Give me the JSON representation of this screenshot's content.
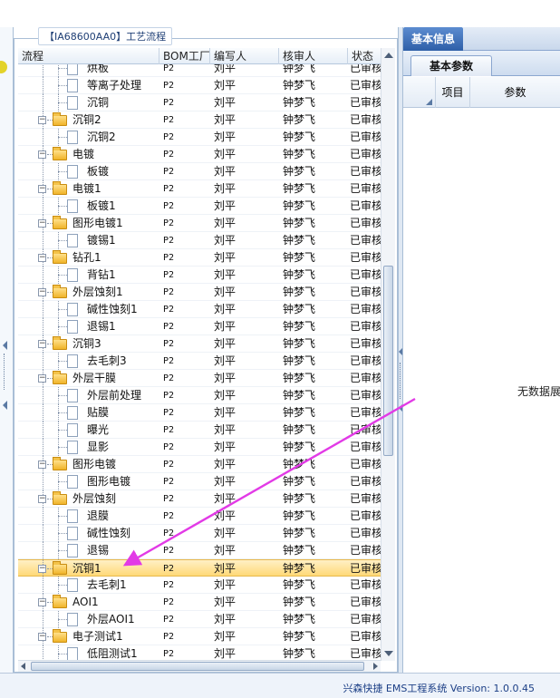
{
  "group_title": "【IA68600AA0】工艺流程",
  "columns": [
    "流程",
    "BOM工厂",
    "编写人",
    "核审人",
    "状态"
  ],
  "rows": [
    {
      "level": 1,
      "label": "烘板",
      "bom": "P2",
      "writer": "刘平",
      "reviewer": "钟梦飞",
      "status": "已审核",
      "selected": false
    },
    {
      "level": 1,
      "label": "等离子处理",
      "bom": "P2",
      "writer": "刘平",
      "reviewer": "钟梦飞",
      "status": "已审核",
      "selected": false
    },
    {
      "level": 1,
      "label": "沉铜",
      "bom": "P2",
      "writer": "刘平",
      "reviewer": "钟梦飞",
      "status": "已审核",
      "selected": false
    },
    {
      "level": 0,
      "label": "沉铜2",
      "bom": "P2",
      "writer": "刘平",
      "reviewer": "钟梦飞",
      "status": "已审核",
      "selected": false
    },
    {
      "level": 1,
      "label": "沉铜2",
      "bom": "P2",
      "writer": "刘平",
      "reviewer": "钟梦飞",
      "status": "已审核",
      "selected": false
    },
    {
      "level": 0,
      "label": "电镀",
      "bom": "P2",
      "writer": "刘平",
      "reviewer": "钟梦飞",
      "status": "已审核",
      "selected": false
    },
    {
      "level": 1,
      "label": "板镀",
      "bom": "P2",
      "writer": "刘平",
      "reviewer": "钟梦飞",
      "status": "已审核",
      "selected": false
    },
    {
      "level": 0,
      "label": "电镀1",
      "bom": "P2",
      "writer": "刘平",
      "reviewer": "钟梦飞",
      "status": "已审核",
      "selected": false
    },
    {
      "level": 1,
      "label": "板镀1",
      "bom": "P2",
      "writer": "刘平",
      "reviewer": "钟梦飞",
      "status": "已审核",
      "selected": false
    },
    {
      "level": 0,
      "label": "图形电镀1",
      "bom": "P2",
      "writer": "刘平",
      "reviewer": "钟梦飞",
      "status": "已审核",
      "selected": false
    },
    {
      "level": 1,
      "label": "镀锡1",
      "bom": "P2",
      "writer": "刘平",
      "reviewer": "钟梦飞",
      "status": "已审核",
      "selected": false
    },
    {
      "level": 0,
      "label": "钻孔1",
      "bom": "P2",
      "writer": "刘平",
      "reviewer": "钟梦飞",
      "status": "已审核",
      "selected": false
    },
    {
      "level": 1,
      "label": "背钻1",
      "bom": "P2",
      "writer": "刘平",
      "reviewer": "钟梦飞",
      "status": "已审核",
      "selected": false
    },
    {
      "level": 0,
      "label": "外层蚀刻1",
      "bom": "P2",
      "writer": "刘平",
      "reviewer": "钟梦飞",
      "status": "已审核",
      "selected": false
    },
    {
      "level": 1,
      "label": "碱性蚀刻1",
      "bom": "P2",
      "writer": "刘平",
      "reviewer": "钟梦飞",
      "status": "已审核",
      "selected": false
    },
    {
      "level": 1,
      "label": "退锡1",
      "bom": "P2",
      "writer": "刘平",
      "reviewer": "钟梦飞",
      "status": "已审核",
      "selected": false
    },
    {
      "level": 0,
      "label": "沉铜3",
      "bom": "P2",
      "writer": "刘平",
      "reviewer": "钟梦飞",
      "status": "已审核",
      "selected": false
    },
    {
      "level": 1,
      "label": "去毛刺3",
      "bom": "P2",
      "writer": "刘平",
      "reviewer": "钟梦飞",
      "status": "已审核",
      "selected": false
    },
    {
      "level": 0,
      "label": "外层干膜",
      "bom": "P2",
      "writer": "刘平",
      "reviewer": "钟梦飞",
      "status": "已审核",
      "selected": false
    },
    {
      "level": 1,
      "label": "外层前处理",
      "bom": "P2",
      "writer": "刘平",
      "reviewer": "钟梦飞",
      "status": "已审核",
      "selected": false
    },
    {
      "level": 1,
      "label": "贴膜",
      "bom": "P2",
      "writer": "刘平",
      "reviewer": "钟梦飞",
      "status": "已审核",
      "selected": false
    },
    {
      "level": 1,
      "label": "曝光",
      "bom": "P2",
      "writer": "刘平",
      "reviewer": "钟梦飞",
      "status": "已审核",
      "selected": false
    },
    {
      "level": 1,
      "label": "显影",
      "bom": "P2",
      "writer": "刘平",
      "reviewer": "钟梦飞",
      "status": "已审核",
      "selected": false
    },
    {
      "level": 0,
      "label": "图形电镀",
      "bom": "P2",
      "writer": "刘平",
      "reviewer": "钟梦飞",
      "status": "已审核",
      "selected": false
    },
    {
      "level": 1,
      "label": "图形电镀",
      "bom": "P2",
      "writer": "刘平",
      "reviewer": "钟梦飞",
      "status": "已审核",
      "selected": false
    },
    {
      "level": 0,
      "label": "外层蚀刻",
      "bom": "P2",
      "writer": "刘平",
      "reviewer": "钟梦飞",
      "status": "已审核",
      "selected": false
    },
    {
      "level": 1,
      "label": "退膜",
      "bom": "P2",
      "writer": "刘平",
      "reviewer": "钟梦飞",
      "status": "已审核",
      "selected": false
    },
    {
      "level": 1,
      "label": "碱性蚀刻",
      "bom": "P2",
      "writer": "刘平",
      "reviewer": "钟梦飞",
      "status": "已审核",
      "selected": false
    },
    {
      "level": 1,
      "label": "退锡",
      "bom": "P2",
      "writer": "刘平",
      "reviewer": "钟梦飞",
      "status": "已审核",
      "selected": false
    },
    {
      "level": 0,
      "label": "沉铜1",
      "bom": "P2",
      "writer": "刘平",
      "reviewer": "钟梦飞",
      "status": "已审核",
      "selected": true
    },
    {
      "level": 1,
      "label": "去毛刺1",
      "bom": "P2",
      "writer": "刘平",
      "reviewer": "钟梦飞",
      "status": "已审核",
      "selected": false
    },
    {
      "level": 0,
      "label": "AOI1",
      "bom": "P2",
      "writer": "刘平",
      "reviewer": "钟梦飞",
      "status": "已审核",
      "selected": false
    },
    {
      "level": 1,
      "label": "外层AOI1",
      "bom": "P2",
      "writer": "刘平",
      "reviewer": "钟梦飞",
      "status": "已审核",
      "selected": false
    },
    {
      "level": 0,
      "label": "电子测试1",
      "bom": "P2",
      "writer": "刘平",
      "reviewer": "钟梦飞",
      "status": "已审核",
      "selected": false
    },
    {
      "level": 1,
      "label": "低阻测试1",
      "bom": "P2",
      "writer": "刘平",
      "reviewer": "钟梦飞",
      "status": "已审核",
      "selected": false
    }
  ],
  "right_panel": {
    "tab": "基本信息",
    "subtab": "基本参数",
    "col_item": "项目",
    "col_param": "参数",
    "empty": "无数据展"
  },
  "status_bar": "兴森快捷 EMS工程系统 Version: 1.0.0.45",
  "colors": {
    "selection": "#ffd978",
    "arrow": "#e23ae6",
    "tab": "#3a6bb5"
  }
}
